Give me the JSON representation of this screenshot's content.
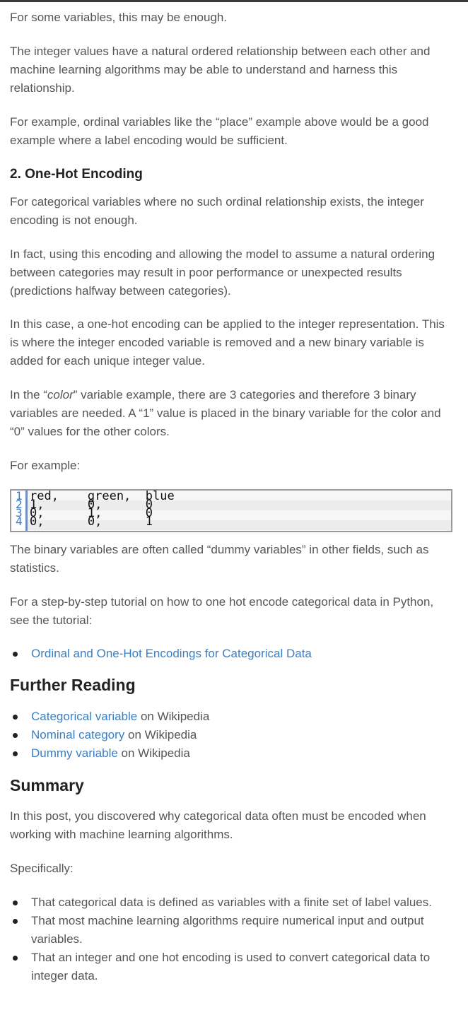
{
  "para1": "For some variables, this may be enough.",
  "para2": "The integer values have a natural ordered relationship between each other and machine learning algorithms may be able to understand and harness this relationship.",
  "para3": "For example, ordinal variables like the “place” example above would be a good example where a label encoding would be sufficient.",
  "heading_onehot": "2. One-Hot Encoding",
  "para4": "For categorical variables where no such ordinal relationship exists, the integer encoding is not enough.",
  "para5": "In fact, using this encoding and allowing the model to assume a natural ordering between categories may result in poor performance or unexpected results (predictions halfway between categories).",
  "para6": "In this case, a one-hot encoding can be applied to the integer representation. This is where the integer encoded variable is removed and a new binary variable is added for each unique integer value.",
  "para7": {
    "before": "In the “",
    "em": "color",
    "after": "” variable example, there are 3 categories and therefore 3 binary variables are needed. A “1” value is placed in the binary variable for the color and “0” values for the other colors."
  },
  "para8": "For example:",
  "code": {
    "line_numbers": [
      "1",
      "2",
      "3",
      "4"
    ],
    "lines": [
      "red,    green,  blue",
      "1,      0,      0",
      "0,      1,      0",
      "0,      0,      1"
    ]
  },
  "para9": "The binary variables are often called “dummy variables” in other fields, such as statistics.",
  "para10": "For a step-by-step tutorial on how to one hot encode categorical data in Python, see the tutorial:",
  "tutorial_link": "Ordinal and One-Hot Encodings for Categorical Data",
  "heading_further": "Further Reading",
  "further_items": [
    {
      "link": "Categorical variable",
      "suffix": " on Wikipedia"
    },
    {
      "link": "Nominal category",
      "suffix": " on Wikipedia"
    },
    {
      "link": "Dummy variable",
      "suffix": " on Wikipedia"
    }
  ],
  "heading_summary": "Summary",
  "para11": "In this post, you discovered why categorical data often must be encoded when working with machine learning algorithms.",
  "para12": "Specifically:",
  "summary_items": [
    "That categorical data is defined as variables with a finite set of label values.",
    "That most machine learning algorithms require numerical input and output variables.",
    "That an integer and one hot encoding is used to convert categorical data to integer data."
  ]
}
